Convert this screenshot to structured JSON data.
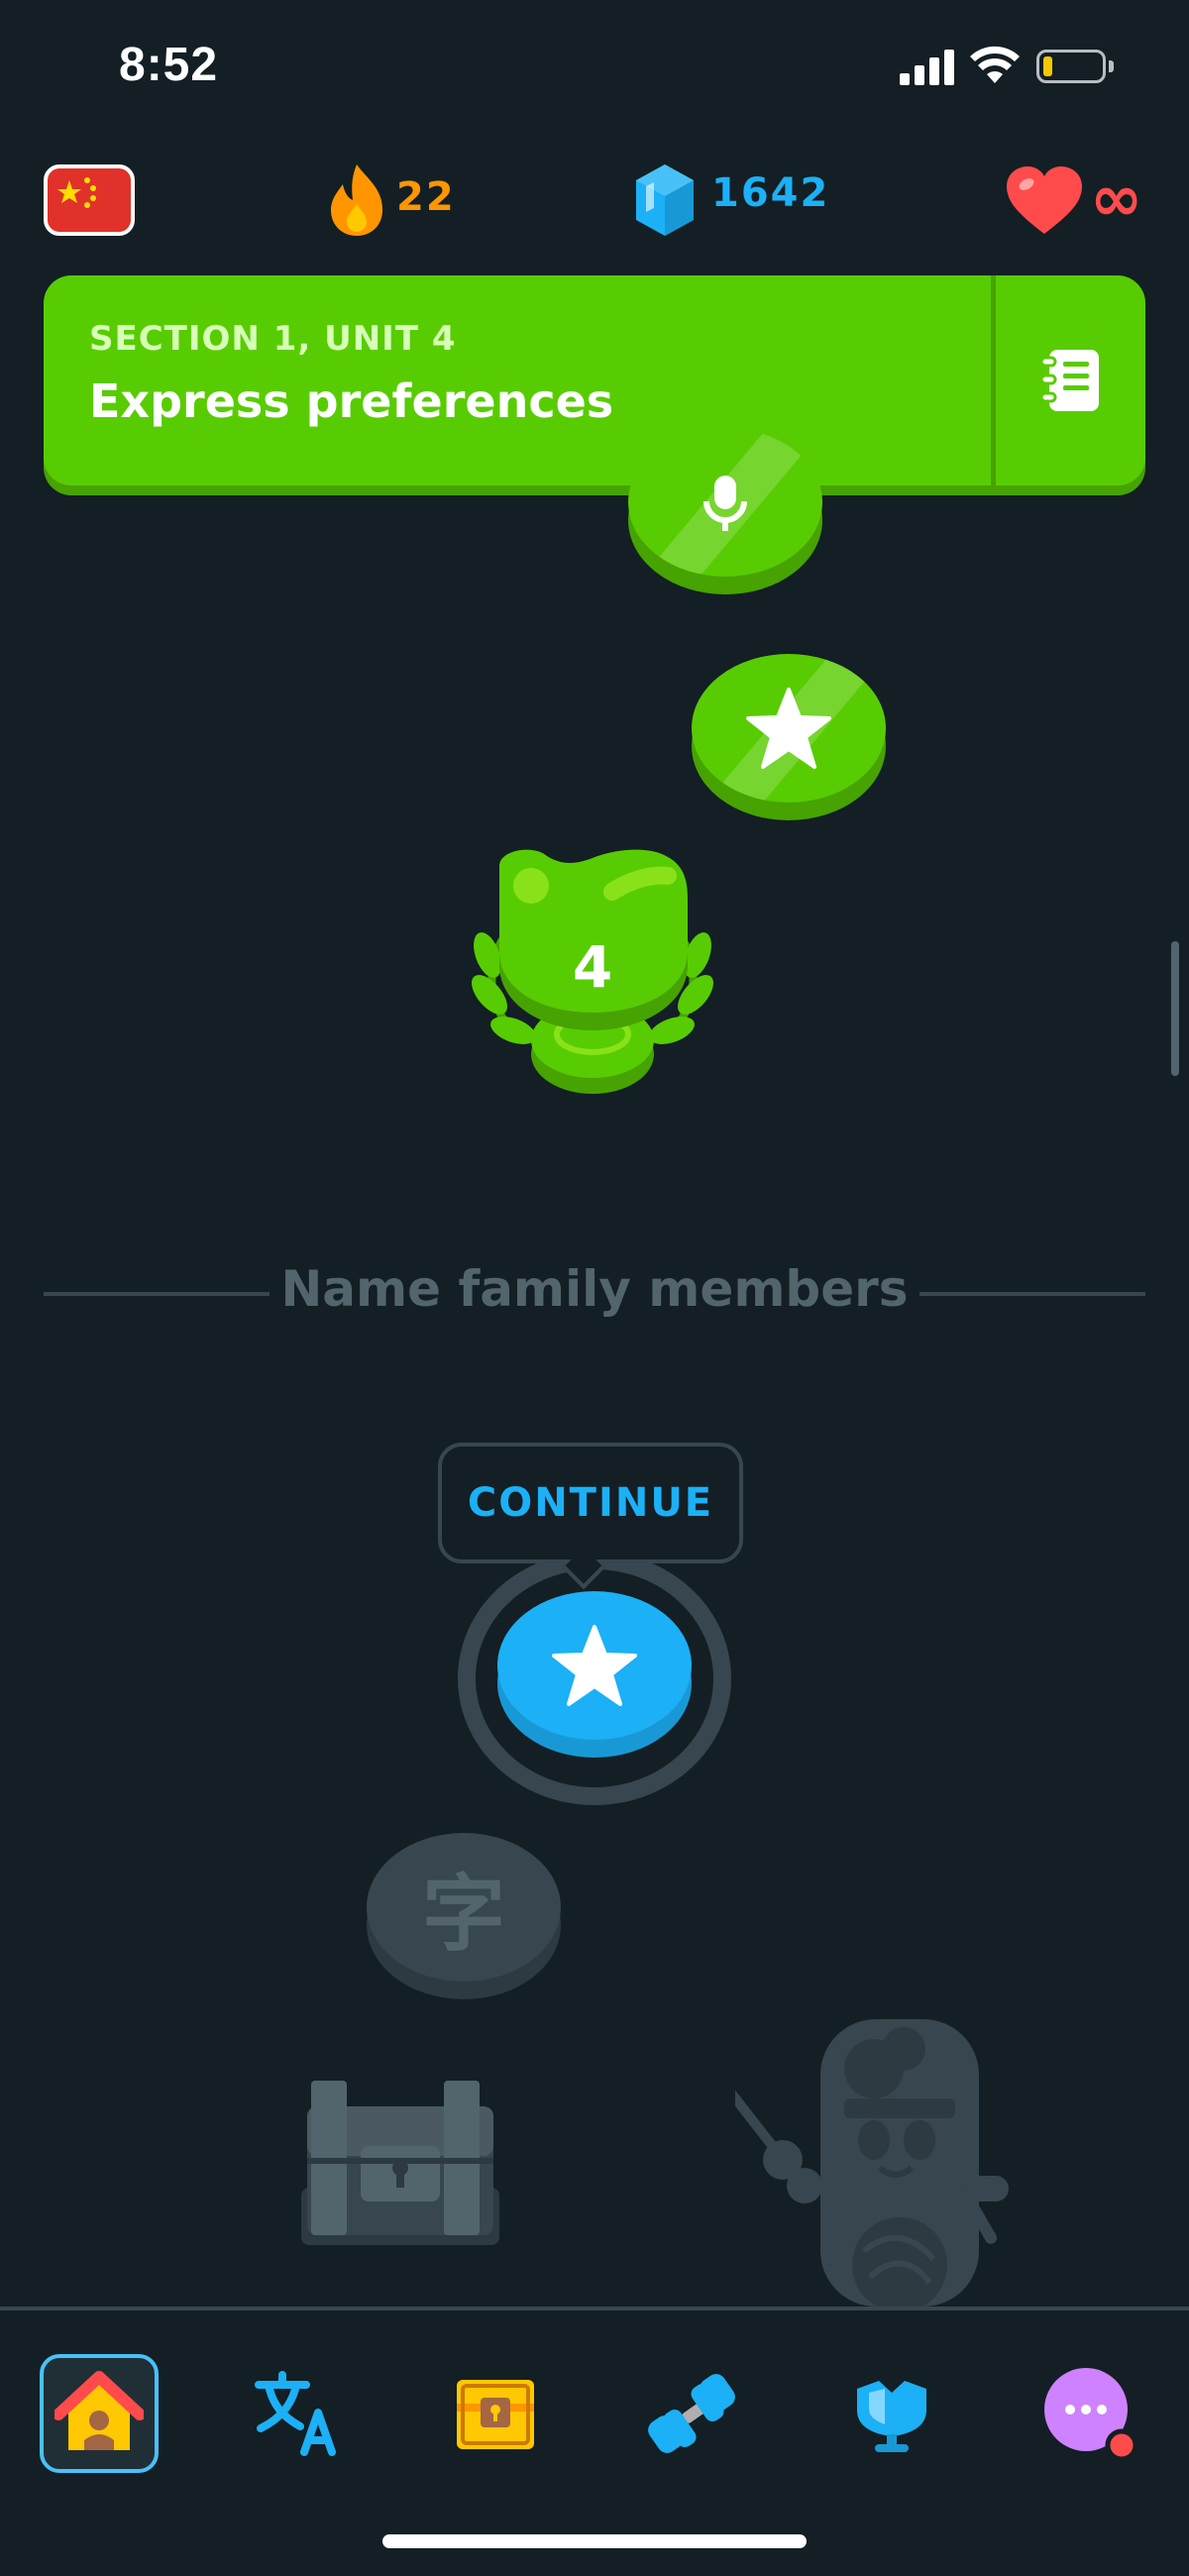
{
  "status_bar": {
    "time": "8:52"
  },
  "top_bar": {
    "course_flag": "china-flag-icon",
    "streak": "22",
    "gems": "1642",
    "hearts": "∞"
  },
  "section": {
    "label": "SECTION 1, UNIT 4",
    "title": "Express preferences"
  },
  "path": {
    "trophy_number": "4",
    "unit_divider": "Name family members",
    "continue_label": "CONTINUE",
    "locked_character": "字"
  },
  "colors": {
    "background": "#131f24",
    "green": "#58cc02",
    "blue": "#1cb0f6",
    "orange": "#ff9600",
    "red": "#ff4b4b"
  },
  "bottom_nav": [
    {
      "name": "learn",
      "icon": "home-icon"
    },
    {
      "name": "characters",
      "icon": "translate-icon"
    },
    {
      "name": "quests",
      "icon": "treasure-chest-icon"
    },
    {
      "name": "practice",
      "icon": "dumbbell-icon"
    },
    {
      "name": "leaderboards",
      "icon": "shield-icon"
    },
    {
      "name": "more",
      "icon": "more-icon"
    }
  ]
}
